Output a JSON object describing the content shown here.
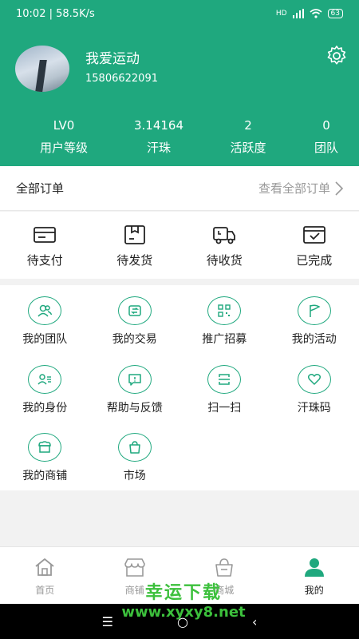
{
  "status_bar": {
    "time": "10:02",
    "speed": "58.5K/s",
    "network": "HD",
    "battery": "63"
  },
  "profile": {
    "name": "我爱运动",
    "phone": "15806622091"
  },
  "stats": [
    {
      "value": "LV0",
      "label": "用户等级"
    },
    {
      "value": "3.14164",
      "label": "汗珠"
    },
    {
      "value": "2",
      "label": "活跃度"
    },
    {
      "value": "0",
      "label": "团队"
    }
  ],
  "orders": {
    "title": "全部订单",
    "view_all": "查看全部订单",
    "items": [
      {
        "label": "待支付",
        "icon": "payment-card-icon"
      },
      {
        "label": "待发货",
        "icon": "package-box-icon"
      },
      {
        "label": "待收货",
        "icon": "delivery-truck-icon"
      },
      {
        "label": "已完成",
        "icon": "completed-tray-icon"
      }
    ]
  },
  "menu": [
    {
      "label": "我的团队",
      "icon": "team-icon"
    },
    {
      "label": "我的交易",
      "icon": "trade-icon"
    },
    {
      "label": "推广招募",
      "icon": "qr-code-icon"
    },
    {
      "label": "我的活动",
      "icon": "flag-icon"
    },
    {
      "label": "我的身份",
      "icon": "identity-icon"
    },
    {
      "label": "帮助与反馈",
      "icon": "feedback-icon"
    },
    {
      "label": "扫一扫",
      "icon": "scan-icon"
    },
    {
      "label": "汗珠码",
      "icon": "heart-icon"
    },
    {
      "label": "我的商铺",
      "icon": "shop-icon"
    },
    {
      "label": "市场",
      "icon": "market-bag-icon"
    }
  ],
  "tabbar": [
    {
      "label": "首页",
      "icon": "home-icon",
      "active": false
    },
    {
      "label": "商铺",
      "icon": "store-icon",
      "active": false
    },
    {
      "label": "商城",
      "icon": "mall-basket-icon",
      "active": false
    },
    {
      "label": "我的",
      "icon": "user-icon",
      "active": true
    }
  ],
  "watermark": {
    "line1": "幸运下载",
    "line2": "www.xyxy8.net"
  },
  "colors": {
    "brand": "#1fa87e",
    "text": "#222222",
    "muted": "#999999"
  }
}
